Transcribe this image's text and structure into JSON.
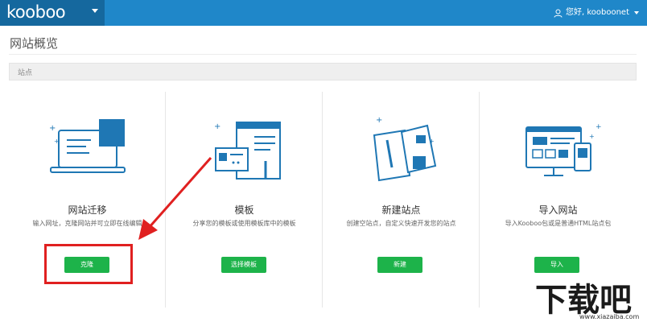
{
  "header": {
    "logo": "kooboo",
    "user_label": "您好, kooboonet"
  },
  "page": {
    "title": "网站概览",
    "section_label": "站点"
  },
  "cards": [
    {
      "title": "网站迁移",
      "desc": "输入网址，克隆网站并可立即在线编辑",
      "button": "克隆"
    },
    {
      "title": "模板",
      "desc": "分享您的模板或使用模板库中的模板",
      "button": "选择模板"
    },
    {
      "title": "新建站点",
      "desc": "创建空站点，自定义快速开发您的站点",
      "button": "新建"
    },
    {
      "title": "导入网站",
      "desc": "导入Kooboo包或是普通HTML站点包",
      "button": "导入"
    }
  ],
  "watermark": {
    "text": "下载吧",
    "site": "www.xiazaiba.com"
  },
  "colors": {
    "topbar": "#1f87c9",
    "brand": "#15689e",
    "button": "#1db34a",
    "illustration_blue": "#1f77b4",
    "highlight": "#e02020"
  }
}
